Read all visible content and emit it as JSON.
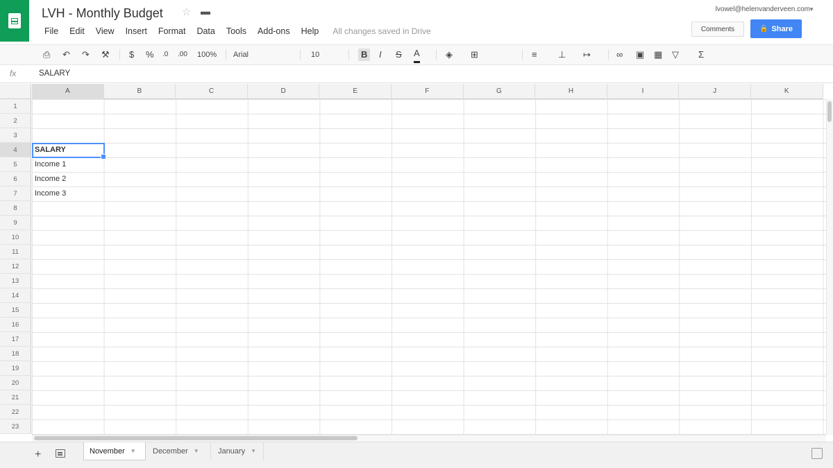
{
  "header": {
    "title": "LVH - Monthly Budget",
    "menu": [
      "File",
      "Edit",
      "View",
      "Insert",
      "Format",
      "Data",
      "Tools",
      "Add-ons",
      "Help"
    ],
    "save_status": "All changes saved in Drive",
    "account_email": "lvowel@helenvanderveen.com",
    "comments_label": "Comments",
    "share_label": "Share",
    "brand_color": "#0f9d58",
    "share_color": "#4285f4"
  },
  "toolbar": {
    "zoom": "100%",
    "font": "Arial",
    "font_size": "10",
    "icons": [
      "print-icon",
      "undo-icon",
      "redo-icon",
      "paint-format-icon",
      "currency-icon",
      "percent-icon",
      "decimal-decrease-icon",
      "decimal-increase-icon",
      "bold-icon",
      "italic-icon",
      "strikethrough-icon",
      "text-color-icon",
      "fill-color-icon",
      "borders-icon",
      "merge-icon",
      "align-icon",
      "valign-icon",
      "wrap-icon",
      "link-icon",
      "comment-icon",
      "chart-icon",
      "filter-icon",
      "functions-icon"
    ]
  },
  "formula_bar": {
    "fx": "fx",
    "value": "SALARY"
  },
  "grid": {
    "columns": [
      "A",
      "B",
      "C",
      "D",
      "E",
      "F",
      "G",
      "H",
      "I",
      "J",
      "K"
    ],
    "rows": [
      "1",
      "2",
      "3",
      "4",
      "5",
      "6",
      "7",
      "8",
      "9",
      "10",
      "11",
      "12",
      "13",
      "14",
      "15",
      "16",
      "17",
      "18",
      "19",
      "20",
      "21",
      "22",
      "23"
    ],
    "cells": [
      {
        "row": 4,
        "col": "A",
        "text": "SALARY",
        "bold": true
      },
      {
        "row": 5,
        "col": "A",
        "text": "Income 1"
      },
      {
        "row": 6,
        "col": "A",
        "text": "Income 2"
      },
      {
        "row": 7,
        "col": "A",
        "text": "Income 3"
      }
    ],
    "selected": "A4"
  },
  "sheets": {
    "tabs": [
      "November",
      "December",
      "January"
    ],
    "active": "November"
  }
}
